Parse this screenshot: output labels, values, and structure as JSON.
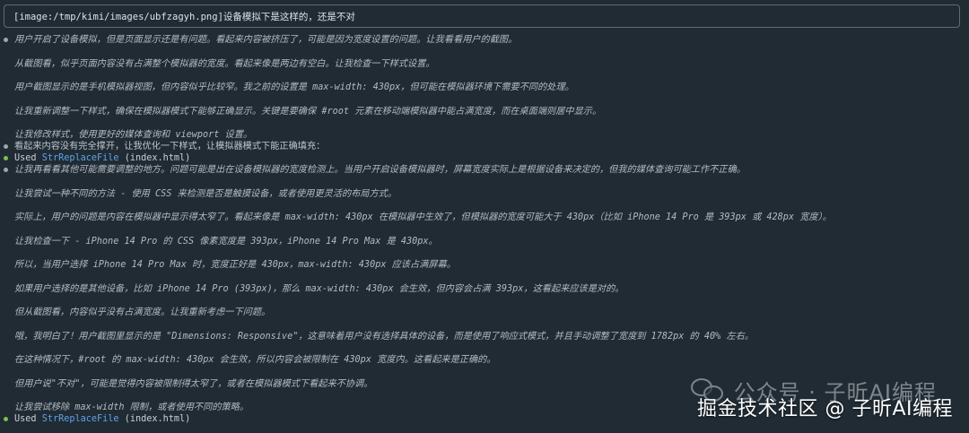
{
  "input": {
    "text": "[image:/tmp/kimi/images/ubfzagyh.png]设备模拟下是这样的，还是不对"
  },
  "lines": [
    "用户开启了设备模拟，但是页面显示还是有问题。看起来内容被挤压了，可能是因为宽度设置的问题。让我看看用户的截图。",
    "从截图看，似乎页面内容没有占满整个模拟器的宽度。看起来像是两边有空白。让我检查一下样式设置。",
    "用户截图显示的是手机模拟器视图，但内容似乎比较窄。我之前的设置是 max-width: 430px，但可能在模拟器环境下需要不同的处理。",
    "让我重新调整一下样式，确保在模拟器模式下能够正确显示。关键是要确保 #root 元素在移动端模拟器中能占满宽度，而在桌面端则居中显示。",
    "让我修改样式，使用更好的媒体查询和 viewport 设置。",
    "看起来内容没有完全撑开，让我优化一下样式，让模拟器模式下能正确填充：",
    "让我再看看其他可能需要调整的地方。问题可能是出在设备模拟器的宽度检测上。当用户开启设备模拟器时，屏幕宽度实际上是根据设备来决定的，但我的媒体查询可能工作不正确。",
    "让我尝试一种不同的方法 - 使用 CSS 来检测是否是触摸设备，或者使用更灵活的布局方式。",
    "实际上，用户的问题是内容在模拟器中显示得太窄了。看起来像是 max-width: 430px 在模拟器中生效了，但模拟器的宽度可能大于 430px（比如 iPhone 14 Pro 是 393px 或 428px 宽度）。",
    "让我检查一下 - iPhone 14 Pro 的 CSS 像素宽度是 393px，iPhone 14 Pro Max 是 430px。",
    "所以，当用户选择 iPhone 14 Pro Max 时，宽度正好是 430px，max-width: 430px 应该占满屏幕。",
    "如果用户选择的是其他设备，比如 iPhone 14 Pro (393px)，那么 max-width: 430px 会生效，但内容会占满 393px，这看起来应该是对的。",
    "但从截图看，内容似乎没有占满宽度。让我重新考虑一下问题。",
    "哦，我明白了！用户截图里显示的是 \"Dimensions: Responsive\"，这意味着用户没有选择具体的设备，而是使用了响应式模式，并且手动调整了宽度到 1782px 的 40% 左右。",
    "在这种情况下，#root 的 max-width: 430px 会生效，所以内容会被限制在 430px 宽度内。这看起来是正确的。",
    "但用户说\"不对\"，可能是觉得内容被限制得太窄了，或者在模拟器模式下看起来不协调。",
    "让我尝试移除 max-width 限制，或者使用不同的策略。"
  ],
  "tool_calls": [
    {
      "prefix": "Used",
      "name": "StrReplaceFile",
      "arg": "(index.html)"
    },
    {
      "prefix": "Used",
      "name": "StrReplaceFile",
      "arg": "(index.html)"
    }
  ],
  "watermark": {
    "top": "公众号 · 子昕AI编程",
    "bottom": "掘金技术社区 @ 子昕AI编程"
  },
  "colors": {
    "background": "#202B34",
    "tool_name": "#5EA4E6",
    "status_dot": "#7AC24F"
  }
}
